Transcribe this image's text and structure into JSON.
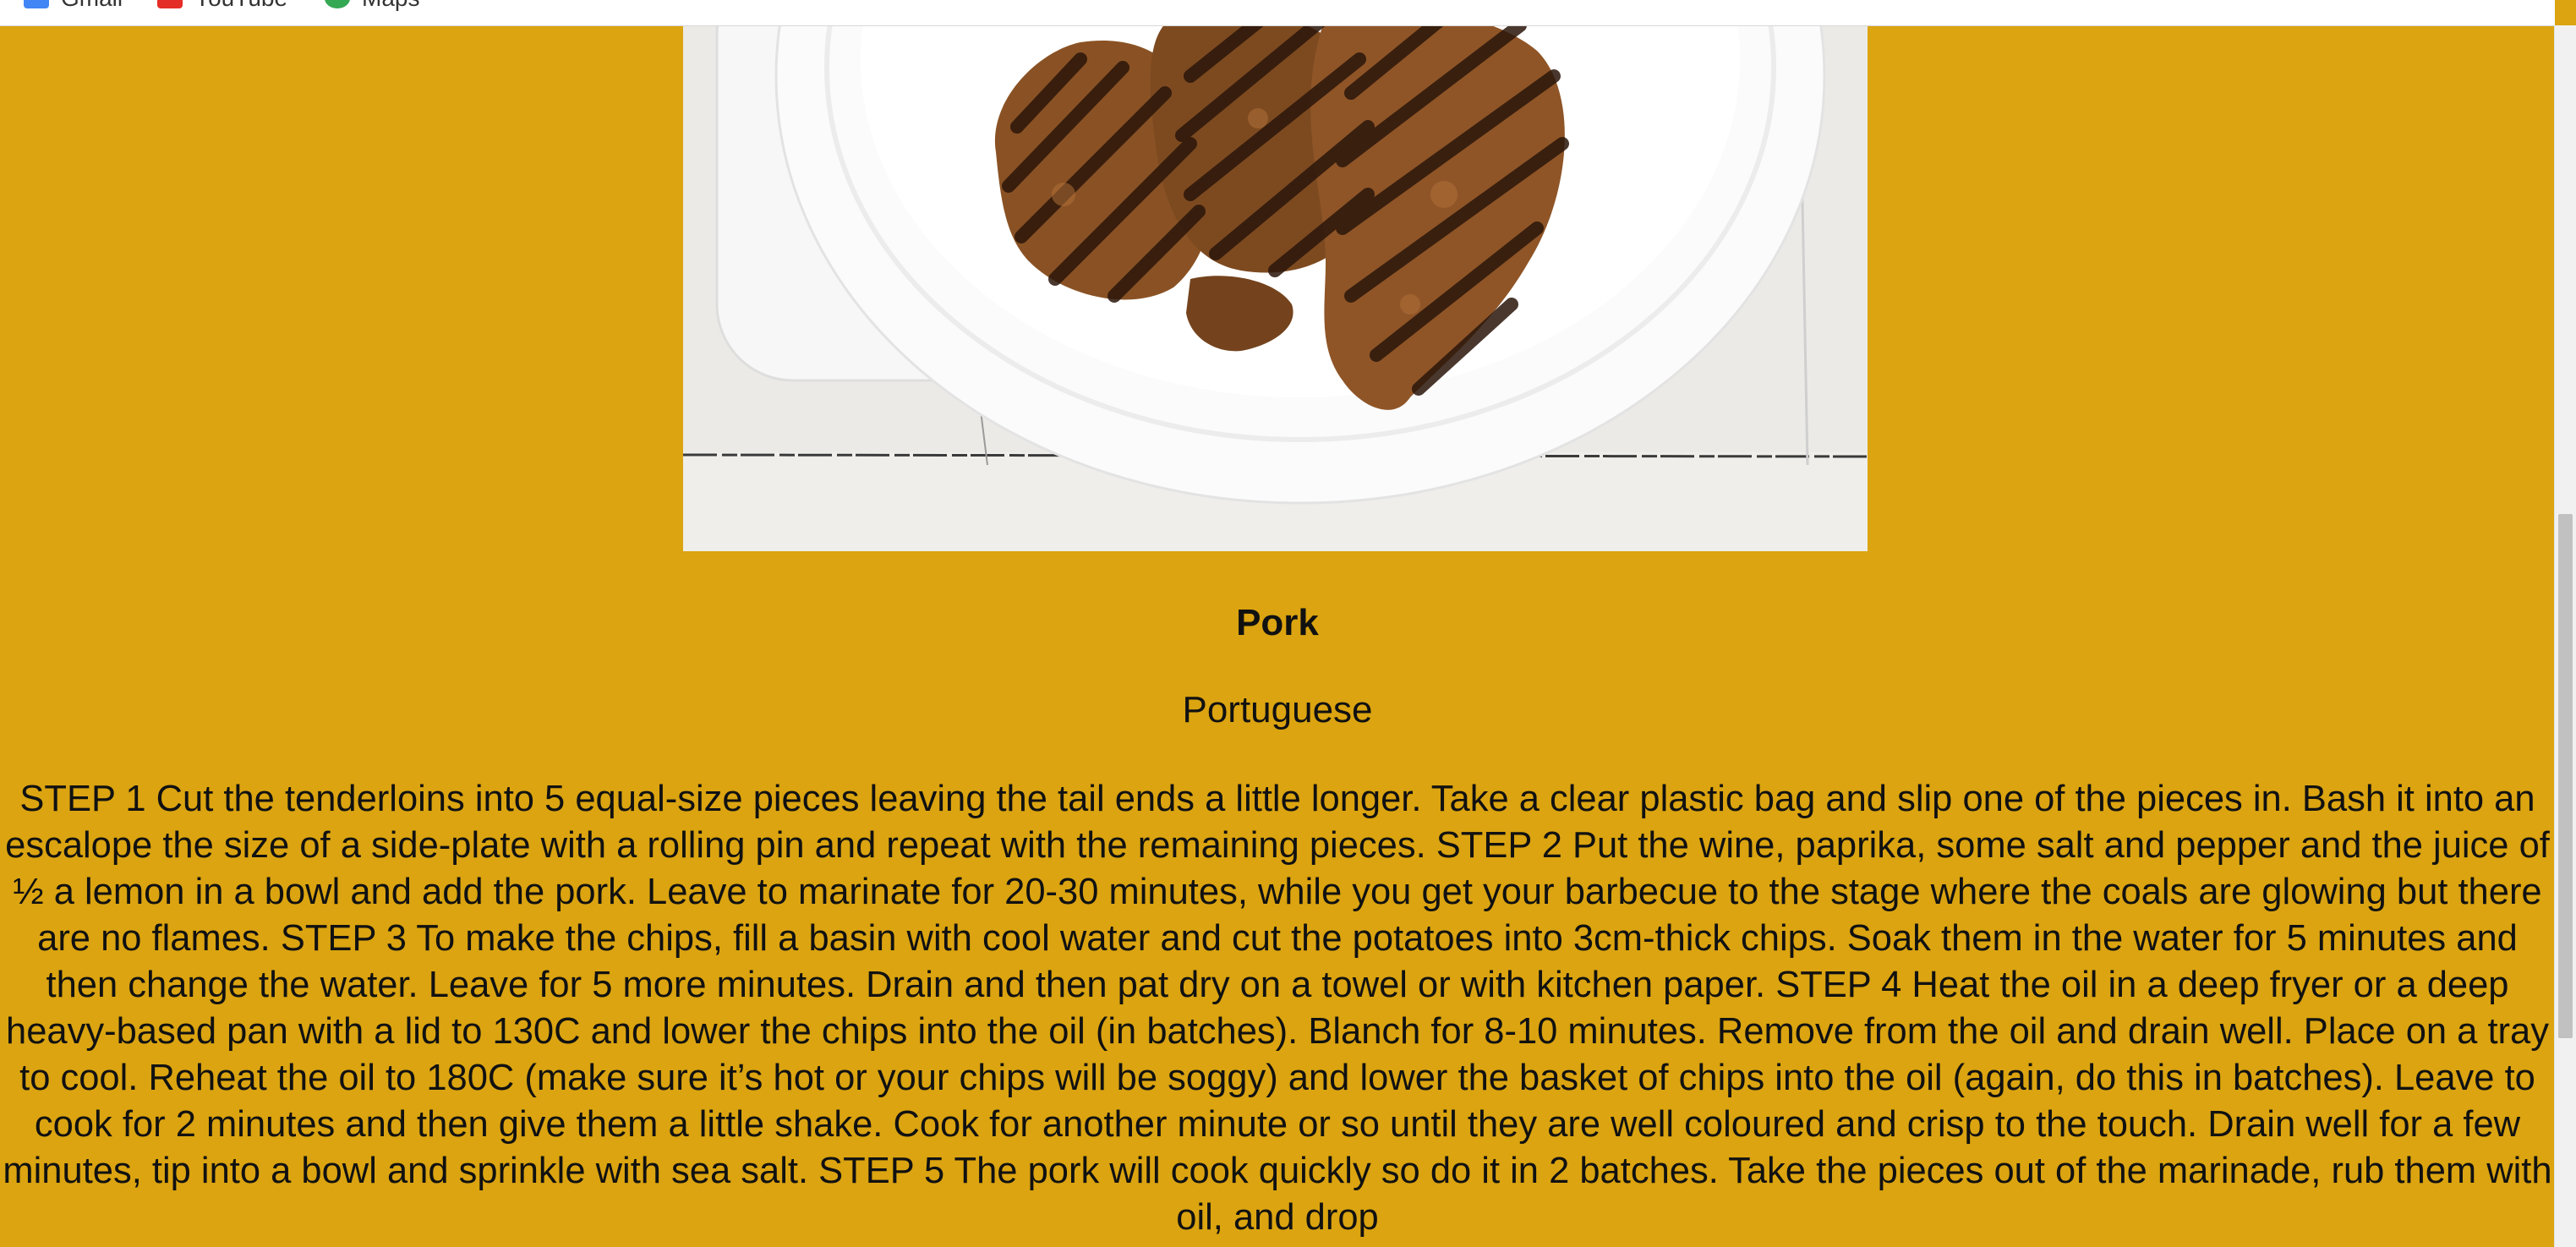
{
  "bookmarks": [
    {
      "label": "Gmail",
      "icon": "gmail-icon",
      "color": "#4285f4"
    },
    {
      "label": "YouTube",
      "icon": "youtube-icon",
      "color": "#ff0000"
    },
    {
      "label": "Maps",
      "icon": "maps-icon",
      "color": "#34a853"
    }
  ],
  "meal": {
    "image_alt": "Grilled pork escalopes on a white plate",
    "name": "Pork",
    "area": "Portuguese",
    "instructions": "STEP 1 Cut the tenderloins into 5 equal-size pieces leaving the tail ends a little longer. Take a clear plastic bag and slip one of the pieces in. Bash it into an escalope the size of a side-plate with a rolling pin and repeat with the remaining pieces. STEP 2 Put the wine, paprika, some salt and pepper and the juice of ½ a lemon in a bowl and add the pork. Leave to marinate for 20-30 minutes, while you get your barbecue to the stage where the coals are glowing but there are no flames. STEP 3 To make the chips, fill a basin with cool water and cut the potatoes into 3cm-thick chips. Soak them in the water for 5 minutes and then change the water. Leave for 5 more minutes. Drain and then pat dry on a towel or with kitchen paper. STEP 4 Heat the oil in a deep fryer or a deep heavy-based pan with a lid to 130C and lower the chips into the oil (in batches). Blanch for 8-10 minutes. Remove from the oil and drain well. Place on a tray to cool. Reheat the oil to 180C (make sure it’s hot or your chips will be soggy) and lower the basket of chips into the oil (again, do this in batches). Leave to cook for 2 minutes and then give them a little shake. Cook for another minute or so until they are well coloured and crisp to the touch. Drain well for a few minutes, tip into a bowl and sprinkle with sea salt. STEP 5 The pork will cook quickly so do it in 2 batches. Take the pieces out of the marinade, rub them with oil, and drop"
  },
  "colors": {
    "page_background": "#dba410",
    "text": "#111111"
  }
}
